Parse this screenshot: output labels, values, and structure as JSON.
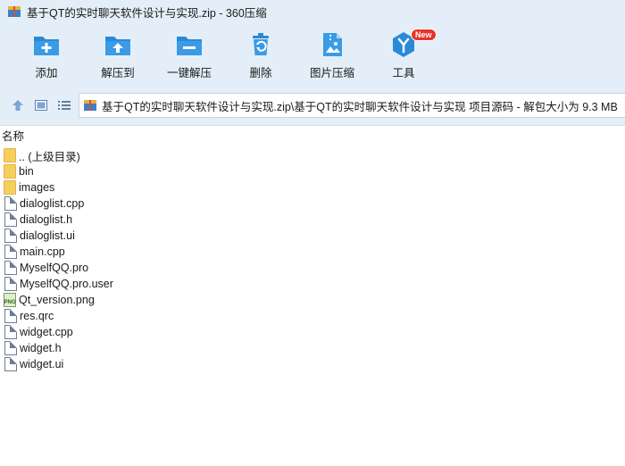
{
  "window": {
    "title": "基于QT的实时聊天软件设计与实现.zip - 360压缩"
  },
  "toolbar": {
    "items": [
      {
        "label": "添加",
        "icon": "add-archive-icon"
      },
      {
        "label": "解压到",
        "icon": "extract-to-icon"
      },
      {
        "label": "一键解压",
        "icon": "one-click-extract-icon"
      },
      {
        "label": "删除",
        "icon": "delete-icon"
      },
      {
        "label": "图片压缩",
        "icon": "image-compress-icon"
      },
      {
        "label": "工具",
        "icon": "tools-icon",
        "badge": "New"
      }
    ],
    "icon_color": "#2b8ad6",
    "badge_color": "#e8332a"
  },
  "address": {
    "path": "基于QT的实时聊天软件设计与实现.zip\\基于QT的实时聊天软件设计与实现 项目源码 - 解包大小为 9.3 MB"
  },
  "columns": {
    "name": "名称"
  },
  "files": [
    {
      "name": ".. (上级目录)",
      "type": "folder"
    },
    {
      "name": "bin",
      "type": "folder"
    },
    {
      "name": "images",
      "type": "folder"
    },
    {
      "name": "dialoglist.cpp",
      "type": "file"
    },
    {
      "name": "dialoglist.h",
      "type": "file"
    },
    {
      "name": "dialoglist.ui",
      "type": "file"
    },
    {
      "name": "main.cpp",
      "type": "file"
    },
    {
      "name": "MyselfQQ.pro",
      "type": "file"
    },
    {
      "name": "MyselfQQ.pro.user",
      "type": "file"
    },
    {
      "name": "Qt_version.png",
      "type": "png"
    },
    {
      "name": "res.qrc",
      "type": "file"
    },
    {
      "name": "widget.cpp",
      "type": "file"
    },
    {
      "name": "widget.h",
      "type": "file"
    },
    {
      "name": "widget.ui",
      "type": "file"
    }
  ],
  "png_icon_label": "PNG"
}
